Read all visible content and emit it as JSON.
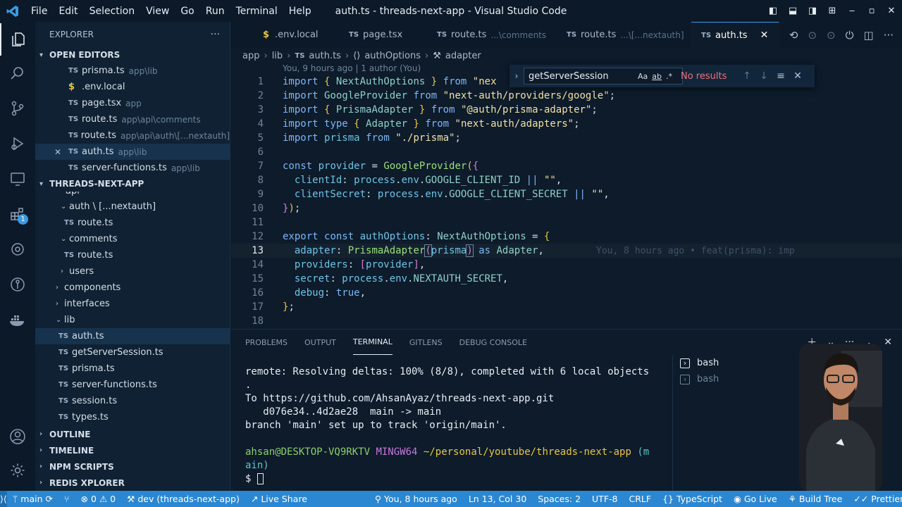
{
  "window": {
    "title": "auth.ts - threads-next-app - Visual Studio Code",
    "menu": [
      "File",
      "Edit",
      "Selection",
      "View",
      "Go",
      "Run",
      "Terminal",
      "Help"
    ]
  },
  "activity": {
    "extensions_badge": "1"
  },
  "sidebar": {
    "header": "EXPLORER",
    "open_editors_label": "OPEN EDITORS",
    "open_editors": [
      {
        "icon": "TS",
        "name": "prisma.ts",
        "desc": "app\\lib"
      },
      {
        "icon": "$",
        "name": ".env.local",
        "desc": ""
      },
      {
        "icon": "TS",
        "name": "page.tsx",
        "desc": "app"
      },
      {
        "icon": "TS",
        "name": "route.ts",
        "desc": "app\\api\\comments"
      },
      {
        "icon": "TS",
        "name": "route.ts",
        "desc": "app\\api\\auth\\[...nextauth]"
      },
      {
        "icon": "TS",
        "name": "auth.ts",
        "desc": "app\\lib"
      },
      {
        "icon": "TS",
        "name": "server-functions.ts",
        "desc": "app\\lib"
      }
    ],
    "project_label": "THREADS-NEXT-APP",
    "tree": [
      {
        "name": "api",
        "kind": "folder-partial"
      },
      {
        "name": "auth \\ [...nextauth]",
        "kind": "folder-open"
      },
      {
        "name": "route.ts",
        "kind": "file"
      },
      {
        "name": "comments",
        "kind": "folder-open"
      },
      {
        "name": "route.ts",
        "kind": "file"
      },
      {
        "name": "users",
        "kind": "folder"
      },
      {
        "name": "components",
        "kind": "folder"
      },
      {
        "name": "interfaces",
        "kind": "folder"
      },
      {
        "name": "lib",
        "kind": "folder-open"
      },
      {
        "name": "auth.ts",
        "kind": "file"
      },
      {
        "name": "getServerSession.ts",
        "kind": "file"
      },
      {
        "name": "prisma.ts",
        "kind": "file"
      },
      {
        "name": "server-functions.ts",
        "kind": "file"
      },
      {
        "name": "session.ts",
        "kind": "file"
      },
      {
        "name": "types.ts",
        "kind": "file"
      }
    ],
    "bottom_sections": [
      "OUTLINE",
      "TIMELINE",
      "NPM SCRIPTS",
      "REDIS XPLORER"
    ]
  },
  "tabs": [
    {
      "icon": "$",
      "name": ".env.local",
      "path": ""
    },
    {
      "icon": "TS",
      "name": "page.tsx",
      "path": ""
    },
    {
      "icon": "TS",
      "name": "route.ts",
      "path": "...\\comments"
    },
    {
      "icon": "TS",
      "name": "route.ts",
      "path": "...\\[...nextauth]"
    },
    {
      "icon": "TS",
      "name": "auth.ts",
      "path": ""
    }
  ],
  "breadcrumb": [
    "app",
    "lib",
    "auth.ts",
    "authOptions",
    "adapter"
  ],
  "editor": {
    "blame_top": "You, 9 hours ago | 1 author (You)",
    "line_numbers": [
      "1",
      "2",
      "3",
      "4",
      "5",
      "6",
      "7",
      "8",
      "9",
      "10",
      "11",
      "12",
      "13",
      "14",
      "15",
      "16",
      "17",
      "18"
    ],
    "inline_blame": "You, 8 hours ago • feat(prisma): imp"
  },
  "find": {
    "value": "getServerSession",
    "options": [
      "Aa",
      "ab",
      ".*"
    ],
    "result": "No results"
  },
  "panel": {
    "tabs": [
      "PROBLEMS",
      "OUTPUT",
      "TERMINAL",
      "GITLENS",
      "DEBUG CONSOLE"
    ],
    "terminal_lines": [
      "remote: Resolving deltas: 100% (8/8), completed with 6 local objects",
      ".",
      "To https://github.com/AhsanAyaz/threads-next-app.git",
      "   d076e34..4d2ae28  main -> main",
      "branch 'main' set up to track 'origin/main'.",
      ""
    ],
    "prompt": {
      "user": "ahsan@DESKTOP-VQ9RKTV",
      "shell": "MINGW64",
      "path": "~/personal/youtube/threads-next-app",
      "branch_a": "(m",
      "branch_b": "ain)",
      "symbol": "$"
    },
    "terminals": [
      "bash",
      "bash"
    ]
  },
  "status": {
    "branch": "main",
    "errors": "0",
    "warnings": "0",
    "dev": "dev (threads-next-app)",
    "live_share": "Live Share",
    "blame": "You, 8 hours ago",
    "position": "Ln 13, Col 30",
    "spaces": "Spaces: 2",
    "encoding": "UTF-8",
    "eol": "CRLF",
    "language": "TypeScript",
    "go_live": "Go Live",
    "build_tree": "Build Tree",
    "prettier": "Prettier"
  }
}
